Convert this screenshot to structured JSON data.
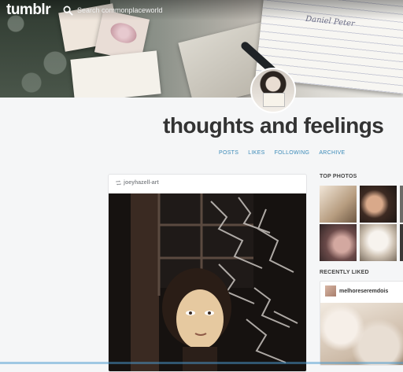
{
  "app": {
    "logo": "tumblr"
  },
  "search": {
    "placeholder": "Search commonplaceworld"
  },
  "header": {
    "signature": "Daniel Peter"
  },
  "blog": {
    "title": "thoughts and feelings"
  },
  "nav": {
    "items": [
      {
        "label": "POSTS"
      },
      {
        "label": "LIKES"
      },
      {
        "label": "FOLLOWING"
      },
      {
        "label": "ARCHIVE"
      }
    ]
  },
  "post": {
    "reblog_source": "joeyhazell-art"
  },
  "sidebar": {
    "top_photos_heading": "TOP PHOTOS",
    "recently_liked_heading": "RECENTLY LIKED",
    "liked_blog": "melhoreseremdois"
  },
  "colors": {
    "accent": "#3b8ab8",
    "title": "#333333",
    "background": "#f5f6f7"
  },
  "icons": [
    "search-icon",
    "reblog-icon"
  ]
}
